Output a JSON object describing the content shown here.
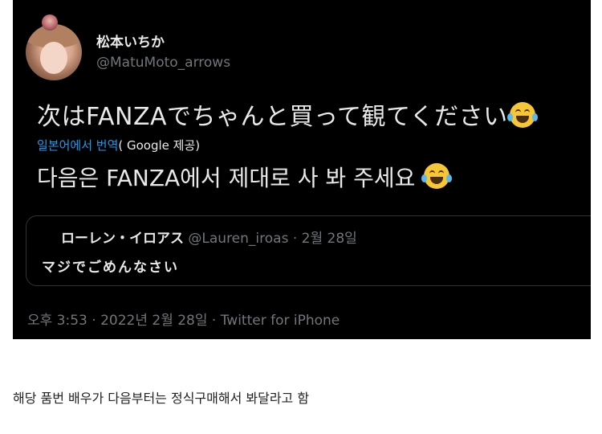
{
  "tweet": {
    "author_name": "松本いちか",
    "author_handle": "@MatuMoto_arrows",
    "text": "次はFANZAでちゃんと買って観てください",
    "emoji": "face-with-tears-of-joy",
    "translate_link": "일본어에서 번역",
    "translate_by": "( Google 제공)",
    "translated_text": "다음은 FANZA에서 제대로 사 봐 주세요",
    "timestamp": "오후 3:53 · 2022년 2월 28일 · Twitter for iPhone"
  },
  "quoted_tweet": {
    "author_name": "ローレン・イロアス",
    "author_handle": "@Lauren_iroas",
    "date": "· 2월 28일",
    "text": "マジでごめんなさい"
  },
  "caption": "해당 품번 배우가 다음부터는 정식구매해서 봐달라고 함",
  "colors": {
    "card_background": "#000000",
    "primary_text": "#e7e9ea",
    "secondary_text": "#71767b",
    "link": "#1d9bf0",
    "border": "#2f3336",
    "page_background": "#ffffff"
  }
}
